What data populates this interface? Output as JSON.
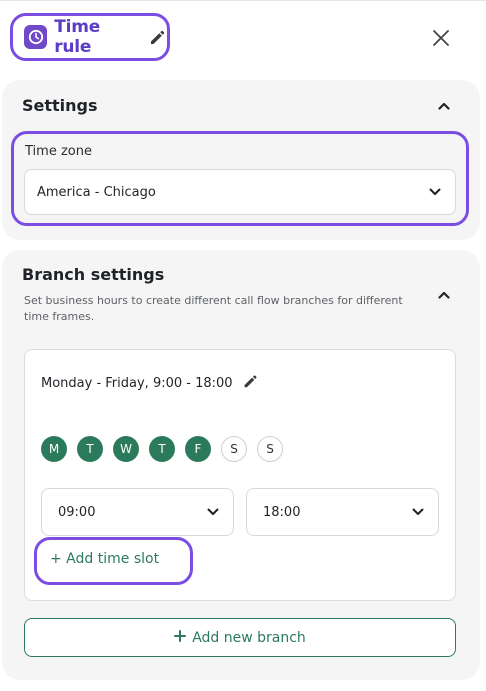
{
  "header": {
    "title": "Time rule",
    "title_icon": "clock-icon",
    "edit_icon": "pencil-icon",
    "close_icon": "close-icon"
  },
  "settings": {
    "title": "Settings",
    "collapse_icon": "chevron-up-icon",
    "time_zone_label": "Time zone",
    "time_zone_value": "America - Chicago"
  },
  "branch_settings": {
    "title": "Branch settings",
    "description": "Set business hours to create different call flow branches for different time frames.",
    "collapse_icon": "chevron-up-icon",
    "rule": {
      "label": "Monday - Friday, 9:00 - 18:00",
      "days": [
        {
          "letter": "M",
          "selected": true
        },
        {
          "letter": "T",
          "selected": true
        },
        {
          "letter": "W",
          "selected": true
        },
        {
          "letter": "T",
          "selected": true
        },
        {
          "letter": "F",
          "selected": true
        },
        {
          "letter": "S",
          "selected": false
        },
        {
          "letter": "S",
          "selected": false
        }
      ],
      "start_time": "09:00",
      "end_time": "18:00",
      "add_time_slot": "+ Add time slot"
    },
    "add_new_branch": "Add new branch"
  },
  "colors": {
    "accent_purple": "#7b4de3",
    "brand_green": "#2c7a5c"
  }
}
